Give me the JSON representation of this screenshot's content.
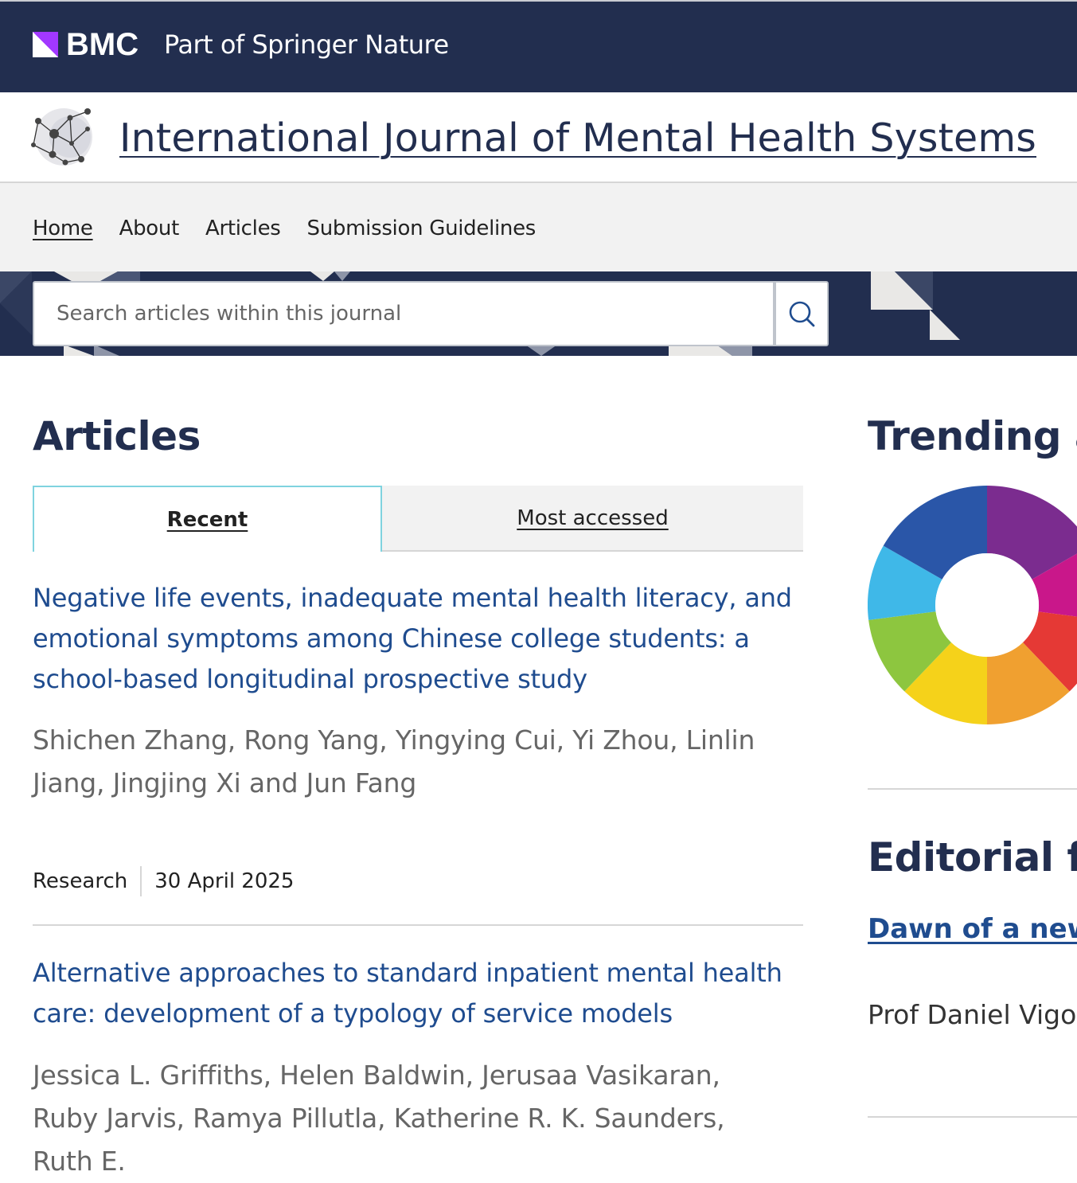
{
  "brand": {
    "name": "BMC",
    "tagline": "Part of Springer Nature",
    "colors": {
      "navy": "#222e4f",
      "link": "#1f4c8f",
      "accent": "#7fd3df",
      "bmc_purple": "#a238ff"
    }
  },
  "journal": {
    "title": "International Journal of Mental Health Systems",
    "logo_icon": "network-molecule-icon"
  },
  "nav": {
    "items": [
      {
        "label": "Home",
        "active": true
      },
      {
        "label": "About",
        "active": false
      },
      {
        "label": "Articles",
        "active": false
      },
      {
        "label": "Submission Guidelines",
        "active": false
      }
    ]
  },
  "search": {
    "placeholder": "Search articles within this journal",
    "button_icon": "search-icon"
  },
  "articles": {
    "heading": "Articles",
    "tabs": [
      {
        "label": "Recent",
        "selected": true
      },
      {
        "label": "Most accessed",
        "selected": false
      }
    ],
    "items": [
      {
        "title": "Negative life events, inadequate mental health literacy, and emotional symptoms among Chinese college students: a school-based longitudinal prospective study",
        "authors": "Shichen Zhang, Rong Yang, Yingying Cui, Yi Zhou, Linlin Jiang, Jingjing Xi and Jun Fang",
        "type": "Research",
        "date": "30 April 2025"
      },
      {
        "title": "Alternative approaches to standard inpatient mental health care: development of a typology of service models",
        "authors": "Jessica L. Griffiths, Helen Baldwin, Jerusaa Vasikaran, Ruby Jarvis, Ramya Pillutla, Katherine R. K. Saunders, Ruth E."
      }
    ]
  },
  "sidebar": {
    "trending_heading": "Trending ar",
    "altmetric_icon": "altmetric-donut-icon",
    "editorial_heading": "Editorial fro",
    "editorial_link": "Dawn of a new",
    "editorial_author": "Prof Daniel Vigo,"
  }
}
